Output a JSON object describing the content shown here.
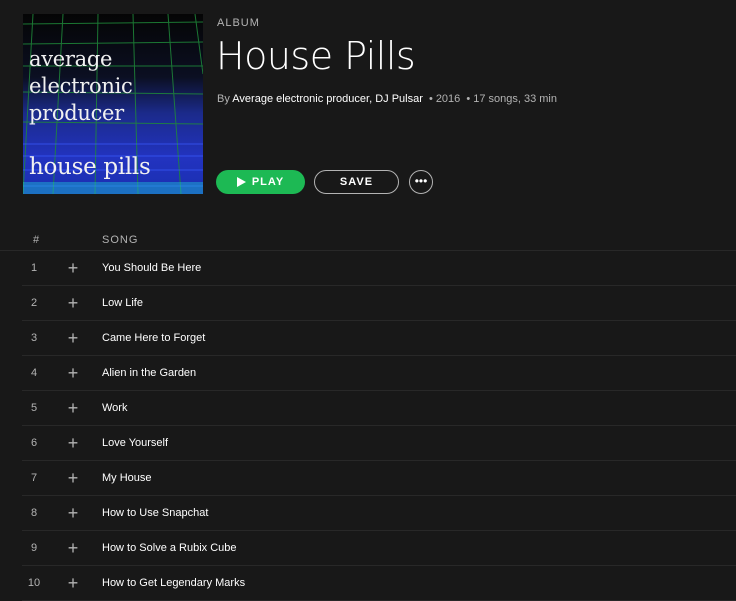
{
  "album": {
    "label": "ALBUM",
    "title": "House Pills",
    "by_prefix": "By",
    "artist1": "Average electronic producer",
    "artist_sep": ",",
    "artist2": "DJ Pulsar",
    "dot": "•",
    "year": "2016",
    "stats": "17 songs, 33 min",
    "cover_lines": [
      "average",
      "electronic",
      "producer"
    ],
    "cover_subtitle": "house pills"
  },
  "actions": {
    "play_label": "PLAY",
    "save_label": "SAVE",
    "more_label": "•••"
  },
  "table": {
    "col_num": "#",
    "col_song": "SONG",
    "add_glyph": "+"
  },
  "tracks": [
    {
      "num": "1",
      "title": "You Should Be Here"
    },
    {
      "num": "2",
      "title": "Low Life"
    },
    {
      "num": "3",
      "title": "Came Here to Forget"
    },
    {
      "num": "4",
      "title": "Alien in the Garden"
    },
    {
      "num": "5",
      "title": "Work"
    },
    {
      "num": "6",
      "title": "Love Yourself"
    },
    {
      "num": "7",
      "title": "My House"
    },
    {
      "num": "8",
      "title": "How to Use Snapchat"
    },
    {
      "num": "9",
      "title": "How to Solve a Rubix Cube"
    },
    {
      "num": "10",
      "title": "How to Get Legendary Marks"
    }
  ],
  "colors": {
    "background": "#181818",
    "play_green": "#1db954",
    "muted_text": "#b3b3b3"
  }
}
